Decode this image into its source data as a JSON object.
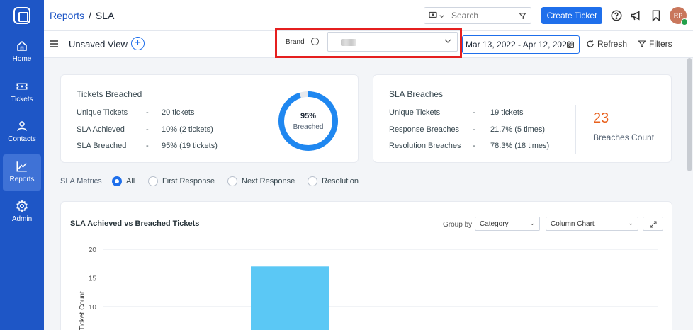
{
  "sidebar": {
    "items": [
      {
        "label": "Home",
        "icon": "home-icon"
      },
      {
        "label": "Tickets",
        "icon": "ticket-icon"
      },
      {
        "label": "Contacts",
        "icon": "contacts-icon"
      },
      {
        "label": "Reports",
        "icon": "reports-icon",
        "active": true
      },
      {
        "label": "Admin",
        "icon": "gear-icon"
      }
    ]
  },
  "header": {
    "breadcrumb_parent": "Reports",
    "breadcrumb_separator": "/",
    "breadcrumb_current": "SLA",
    "search_placeholder": "Search",
    "create_button": "Create Ticket",
    "avatar_initials": "RP"
  },
  "toolbar": {
    "view_name": "Unsaved View",
    "brand_label": "Brand",
    "date_range": "Mar 13, 2022 - Apr 12, 2022",
    "refresh_label": "Refresh",
    "filters_label": "Filters"
  },
  "tickets_breached": {
    "title": "Tickets Breached",
    "rows": [
      {
        "label": "Unique Tickets",
        "dash": "-",
        "value": "20 tickets"
      },
      {
        "label": "SLA Achieved",
        "dash": "-",
        "value": "10% (2 tickets)"
      },
      {
        "label": "SLA Breached",
        "dash": "-",
        "value": "95% (19 tickets)"
      }
    ],
    "donut_percent": "95%",
    "donut_label": "Breached",
    "donut_fraction": 0.95
  },
  "sla_breaches": {
    "title": "SLA Breaches",
    "rows": [
      {
        "label": "Unique Tickets",
        "dash": "-",
        "value": "19 tickets"
      },
      {
        "label": "Response Breaches",
        "dash": "-",
        "value": "21.7% (5 times)"
      },
      {
        "label": "Resolution Breaches",
        "dash": "-",
        "value": "78.3% (18 times)"
      }
    ],
    "count": "23",
    "count_label": "Breaches Count"
  },
  "sla_metrics": {
    "label": "SLA Metrics",
    "options": [
      "All",
      "First Response",
      "Next Response",
      "Resolution"
    ],
    "selected": "All"
  },
  "chart_panel": {
    "title": "SLA Achieved vs Breached Tickets",
    "group_by_label": "Group by",
    "group_by_value": "Category",
    "chart_type_value": "Column Chart"
  },
  "colors": {
    "sidebar": "#1e56c6",
    "accent": "#1f6feb",
    "bar": "#5bc8f5",
    "highlight": "#e51f1f",
    "count": "#e8601c"
  },
  "chart_data": {
    "type": "bar",
    "title": "SLA Achieved vs Breached Tickets",
    "ylabel": "Ticket Count",
    "xlabel": "",
    "ylim": [
      10,
      20
    ],
    "yticks": [
      "20",
      "15",
      "10"
    ],
    "categories": [
      ""
    ],
    "values": [
      17
    ],
    "grid": true
  }
}
